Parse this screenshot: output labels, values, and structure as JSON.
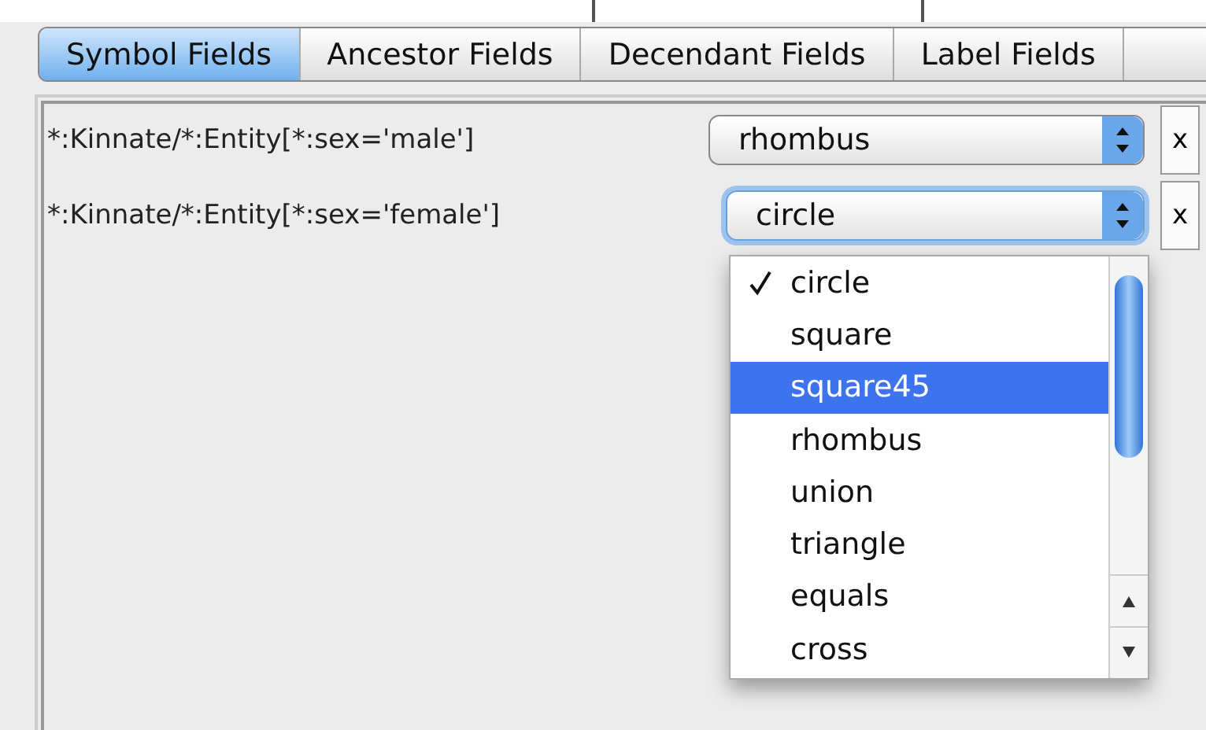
{
  "tabs": [
    {
      "label": "Symbol Fields",
      "selected": true
    },
    {
      "label": "Ancestor Fields",
      "selected": false
    },
    {
      "label": "Decendant Fields",
      "selected": false
    },
    {
      "label": "Label Fields",
      "selected": false
    }
  ],
  "rows": [
    {
      "path": "*:Kinnate/*:Entity[*:sex='male']",
      "value": "rhombus",
      "focused": false,
      "remove": "x"
    },
    {
      "path": "*:Kinnate/*:Entity[*:sex='female']",
      "value": "circle",
      "focused": true,
      "remove": "x"
    }
  ],
  "dropdown": {
    "items": [
      {
        "label": "circle",
        "checked": true,
        "selected": false
      },
      {
        "label": "square",
        "checked": false,
        "selected": false
      },
      {
        "label": "square45",
        "checked": false,
        "selected": true
      },
      {
        "label": "rhombus",
        "checked": false,
        "selected": false
      },
      {
        "label": "union",
        "checked": false,
        "selected": false
      },
      {
        "label": "triangle",
        "checked": false,
        "selected": false
      },
      {
        "label": "equals",
        "checked": false,
        "selected": false
      },
      {
        "label": "cross",
        "checked": false,
        "selected": false
      }
    ]
  }
}
